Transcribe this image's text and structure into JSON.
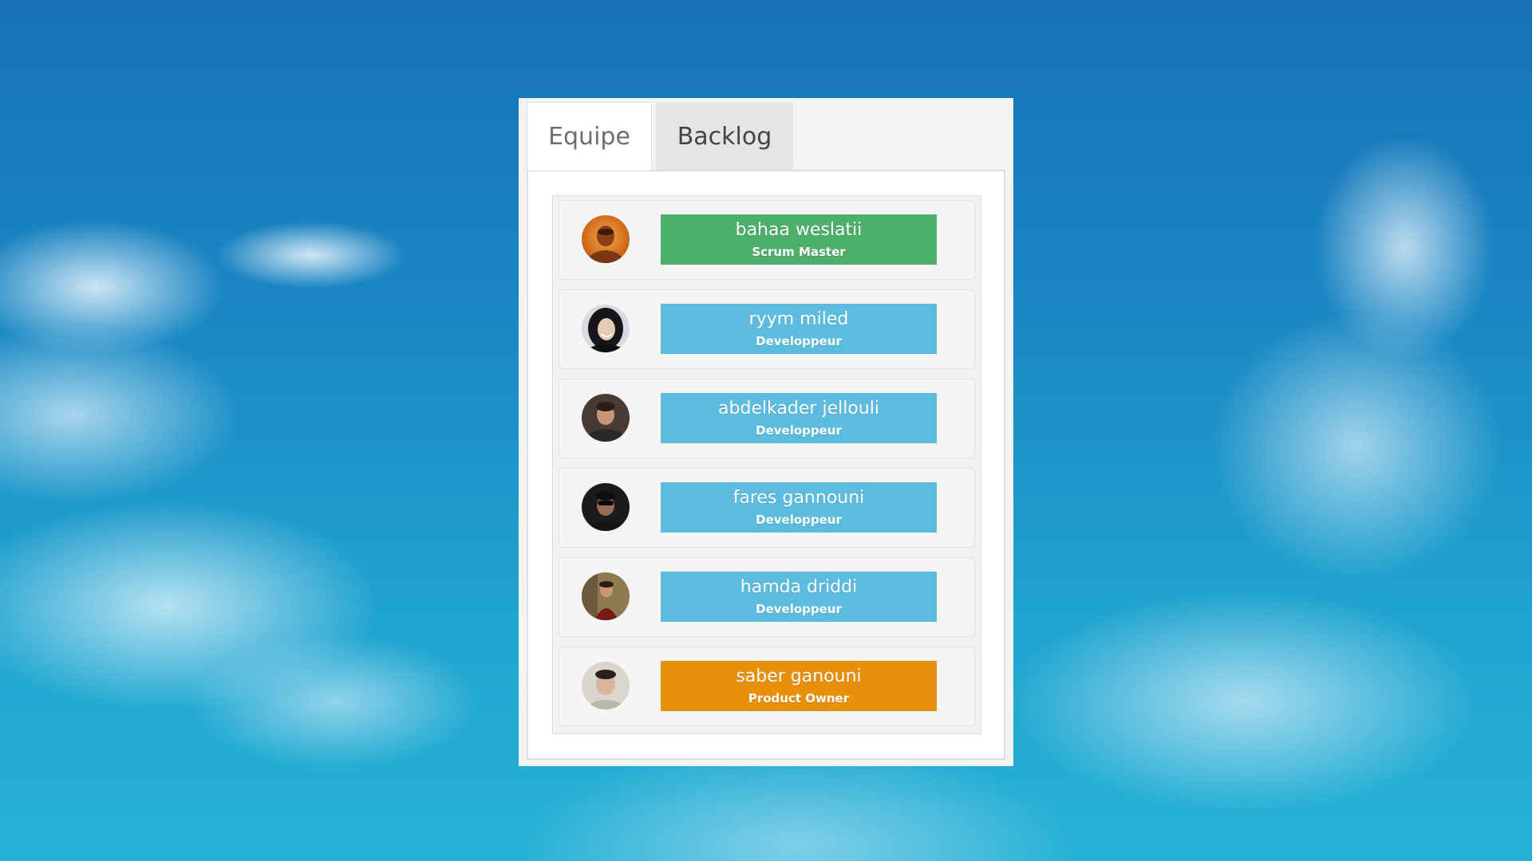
{
  "tabs": [
    {
      "label": "Equipe",
      "active": true
    },
    {
      "label": "Backlog",
      "active": false
    }
  ],
  "colors": {
    "scrum_master": "#4caf6a",
    "developer": "#5bbcdf",
    "product_owner": "#e8900a"
  },
  "members": [
    {
      "name": "bahaa weslatii",
      "role": "Scrum Master",
      "role_color": "#4caf6a",
      "avatar": "portrait-avatar-orange"
    },
    {
      "name": "ryym miled",
      "role": "Developpeur",
      "role_color": "#5bbcdf",
      "avatar": "portrait-avatar-hijab"
    },
    {
      "name": "abdelkader jellouli",
      "role": "Developpeur",
      "role_color": "#5bbcdf",
      "avatar": "portrait-avatar-dark"
    },
    {
      "name": "fares gannouni",
      "role": "Developpeur",
      "role_color": "#5bbcdf",
      "avatar": "portrait-avatar-sunglasses"
    },
    {
      "name": "hamda driddi",
      "role": "Developpeur",
      "role_color": "#5bbcdf",
      "avatar": "portrait-avatar-red"
    },
    {
      "name": "saber ganouni",
      "role": "Product Owner",
      "role_color": "#e8900a",
      "avatar": "portrait-avatar-light"
    }
  ]
}
